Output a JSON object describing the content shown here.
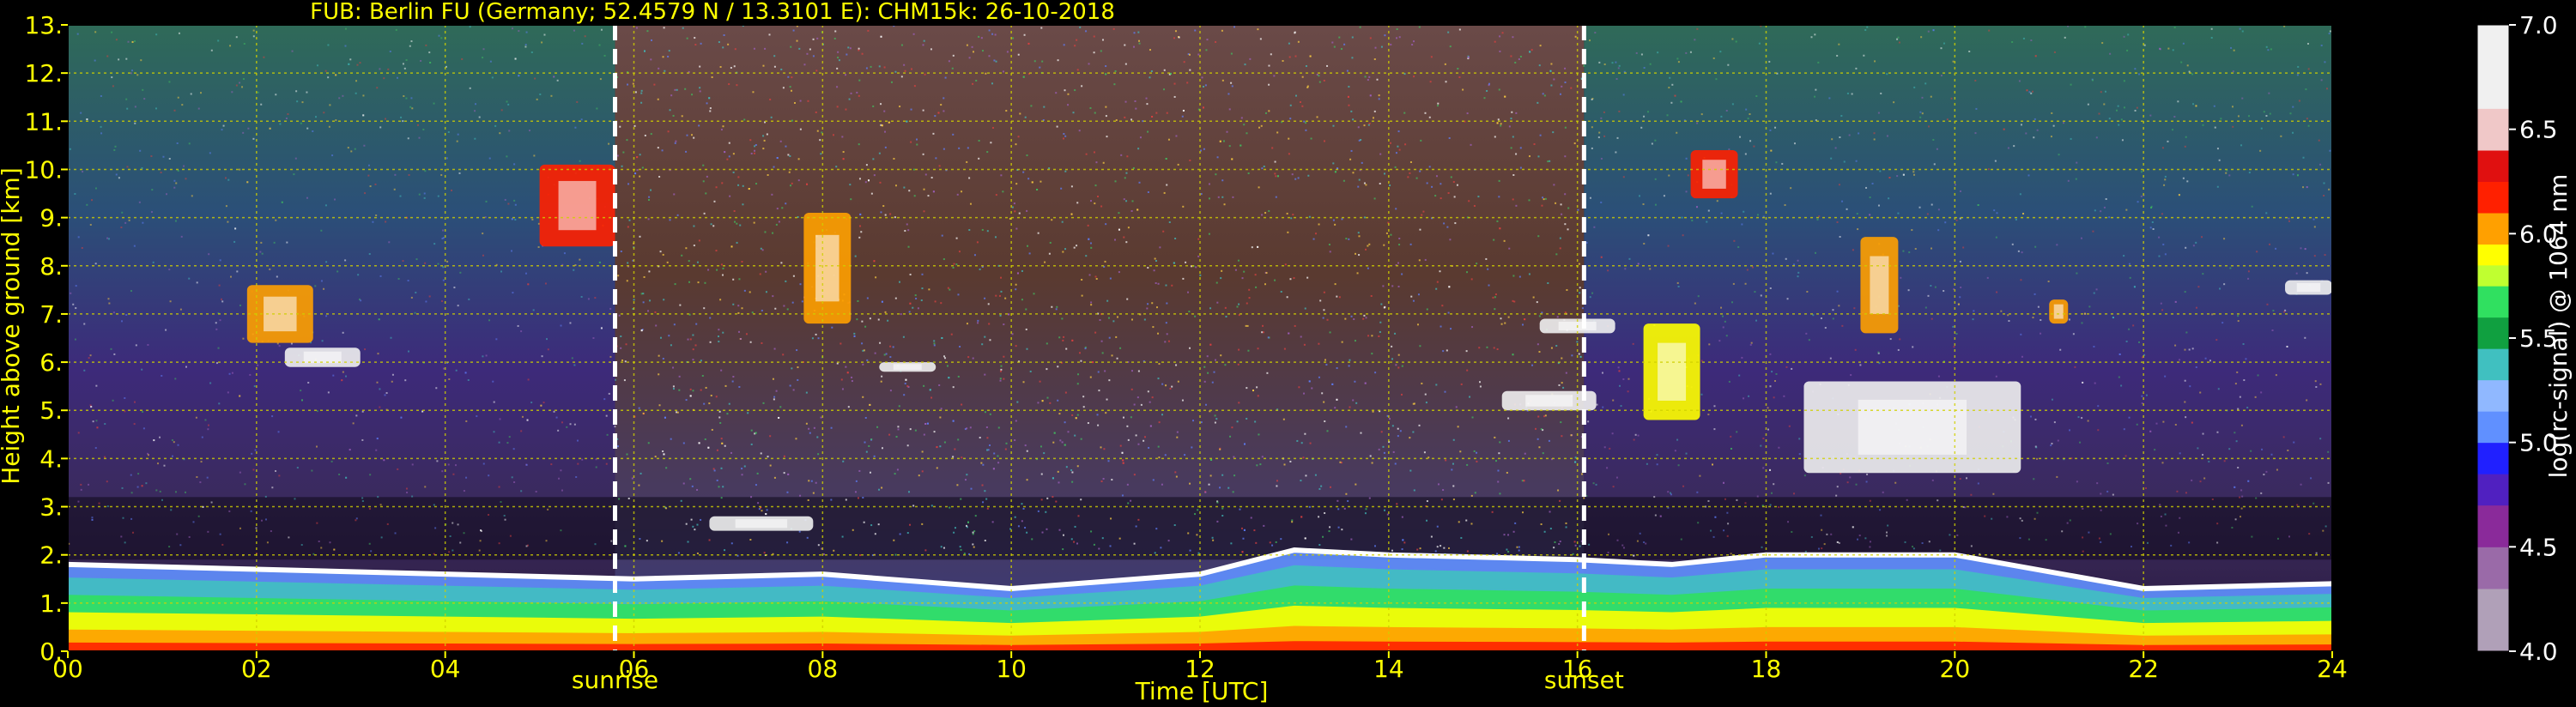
{
  "chart_data": {
    "type": "heatmap",
    "title": "FUB: Berlin FU (Germany; 52.4579 N / 13.3101 E):    CHM15k: 26-10-2018",
    "xlabel": "Time [UTC]",
    "ylabel": "Height above ground [km]",
    "colorbar_label": "log(rc-signal) @ 1064 nm",
    "xlim": [
      0,
      24
    ],
    "ylim": [
      0,
      13
    ],
    "x_ticks": [
      "00",
      "02",
      "04",
      "06",
      "08",
      "10",
      "12",
      "14",
      "16",
      "18",
      "20",
      "22",
      "24"
    ],
    "y_ticks": [
      "0.",
      "1.",
      "2.",
      "3.",
      "4.",
      "5.",
      "6.",
      "7.",
      "8.",
      "9.",
      "10.",
      "11.",
      "12.",
      "13."
    ],
    "colorbar_range": [
      4.0,
      7.0
    ],
    "colorbar_ticks": [
      "4.0",
      "4.5",
      "5.0",
      "5.5",
      "6.0",
      "6.5",
      "7.0"
    ],
    "grid": true,
    "events": [
      {
        "label": "sunrise",
        "time": 5.8
      },
      {
        "label": "sunset",
        "time": 16.07
      }
    ],
    "cloud_features": [
      {
        "t0": 5.0,
        "t1": 5.8,
        "h0": 8.4,
        "h1": 10.1,
        "level": 6.1
      },
      {
        "t0": 1.9,
        "t1": 2.6,
        "h0": 6.4,
        "h1": 7.6,
        "level": 6.0
      },
      {
        "t0": 2.3,
        "t1": 3.1,
        "h0": 5.9,
        "h1": 6.3,
        "level": 6.8
      },
      {
        "t0": 7.8,
        "t1": 8.3,
        "h0": 6.8,
        "h1": 9.1,
        "level": 6.0
      },
      {
        "t0": 6.8,
        "t1": 7.9,
        "h0": 2.5,
        "h1": 2.8,
        "level": 6.8
      },
      {
        "t0": 8.6,
        "t1": 9.2,
        "h0": 5.8,
        "h1": 6.0,
        "level": 6.9
      },
      {
        "t0": 15.6,
        "t1": 16.4,
        "h0": 6.6,
        "h1": 6.9,
        "level": 6.9
      },
      {
        "t0": 15.2,
        "t1": 16.2,
        "h0": 5.0,
        "h1": 5.4,
        "level": 6.9
      },
      {
        "t0": 16.7,
        "t1": 17.3,
        "h0": 4.8,
        "h1": 6.8,
        "level": 5.9
      },
      {
        "t0": 17.2,
        "t1": 17.7,
        "h0": 9.4,
        "h1": 10.4,
        "level": 6.1
      },
      {
        "t0": 18.4,
        "t1": 20.7,
        "h0": 3.7,
        "h1": 5.6,
        "level": 6.9
      },
      {
        "t0": 19.0,
        "t1": 19.4,
        "h0": 6.6,
        "h1": 8.6,
        "level": 6.0
      },
      {
        "t0": 21.0,
        "t1": 21.2,
        "h0": 6.8,
        "h1": 7.3,
        "level": 6.0
      },
      {
        "t0": 23.5,
        "t1": 24.0,
        "h0": 7.4,
        "h1": 7.7,
        "level": 6.9
      }
    ],
    "boundary_layer": [
      {
        "time": 0.0,
        "top_km": 1.8
      },
      {
        "time": 2.0,
        "top_km": 1.7
      },
      {
        "time": 4.0,
        "top_km": 1.6
      },
      {
        "time": 6.0,
        "top_km": 1.5
      },
      {
        "time": 8.0,
        "top_km": 1.6
      },
      {
        "time": 10.0,
        "top_km": 1.3
      },
      {
        "time": 12.0,
        "top_km": 1.6
      },
      {
        "time": 13.0,
        "top_km": 2.1
      },
      {
        "time": 14.0,
        "top_km": 2.0
      },
      {
        "time": 16.0,
        "top_km": 1.9
      },
      {
        "time": 17.0,
        "top_km": 1.8
      },
      {
        "time": 18.0,
        "top_km": 2.0
      },
      {
        "time": 20.0,
        "top_km": 2.0
      },
      {
        "time": 22.0,
        "top_km": 1.3
      },
      {
        "time": 24.0,
        "top_km": 1.4
      }
    ]
  }
}
